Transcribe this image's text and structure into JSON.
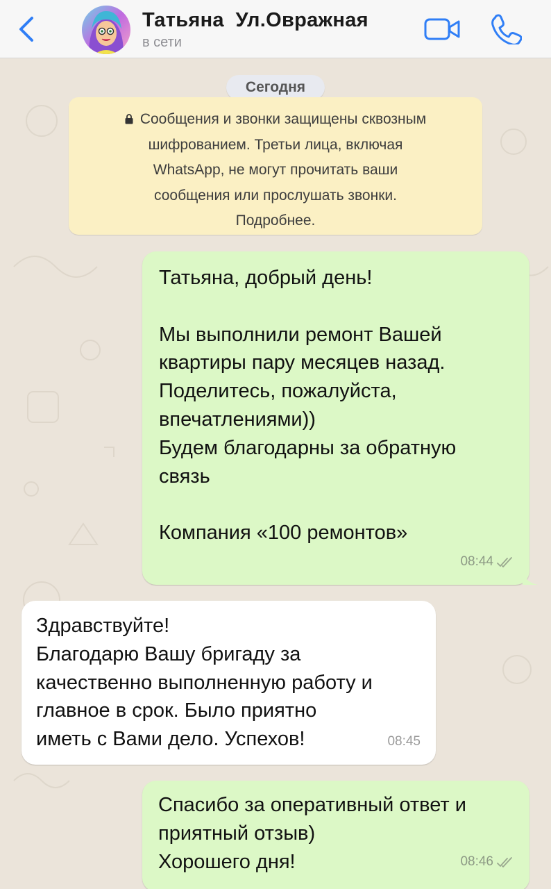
{
  "header": {
    "contact_name": "Татьяна  Ул.Овражная",
    "status": "в сети",
    "colors": {
      "accent": "#2f7ef6"
    }
  },
  "chat": {
    "date_label": "Сегодня",
    "encryption_notice": {
      "lines": [
        "Сообщения и звонки защищены сквозным",
        "шифрованием. Третьи лица, включая",
        "WhatsApp, не могут прочитать ваши",
        "сообщения или прослушать звонки.",
        "Подробнее."
      ]
    },
    "messages": [
      {
        "direction": "outgoing",
        "text": "Татьяна, добрый день!\n\nМы выполнили ремонт Вашей\nквартиры пару месяцев назад.\nПоделитесь, пожалуйста,\nвпечатлениями))\nБудем благодарны за обратную\nсвязь\n\nКомпания «100 ремонтов»",
        "time": "08:44",
        "status": "read-double-check"
      },
      {
        "direction": "incoming",
        "text": "Здравствуйте!\nБлагодарю Вашу бригаду за\nкачественно выполненную работу и\nглавное в срок. Было приятно\nиметь с Вами дело. Успехов!",
        "time": "08:45"
      },
      {
        "direction": "outgoing",
        "text": "Спасибо за оперативный ответ и\nприятный отзыв)\nХорошего дня!",
        "time": "08:46",
        "status": "read-double-check"
      }
    ],
    "colors": {
      "outgoing_bubble": "#dcf8c6",
      "incoming_bubble": "#ffffff",
      "notice_bg": "#fbf0c4",
      "wallpaper": "#ebe4da"
    }
  }
}
